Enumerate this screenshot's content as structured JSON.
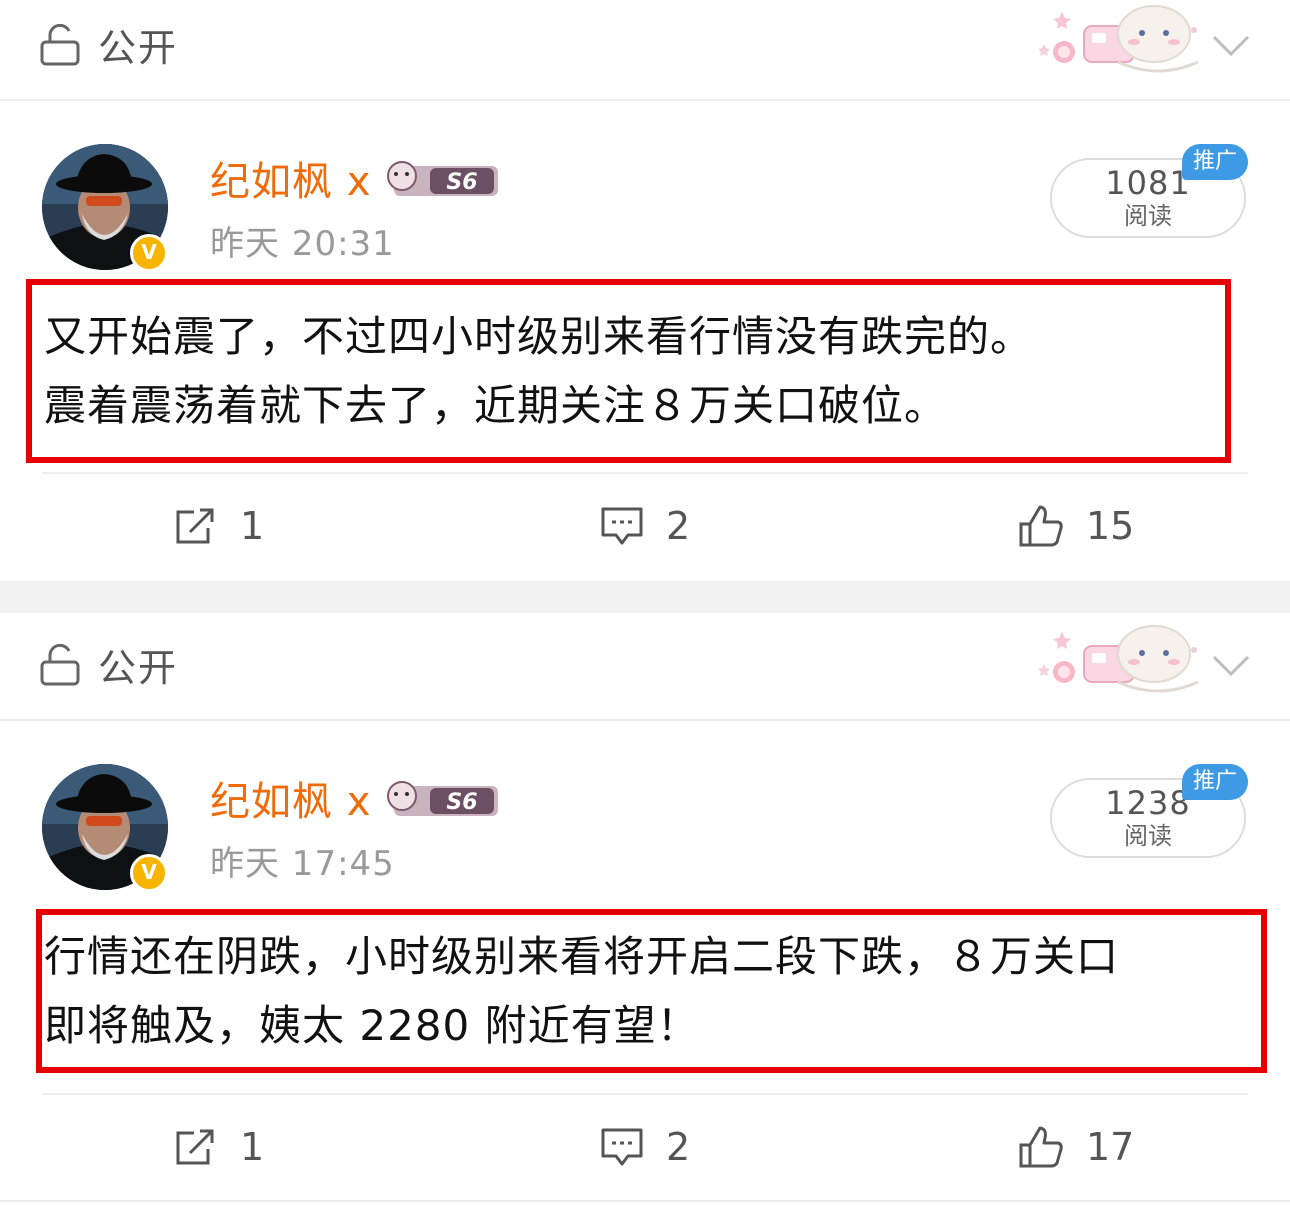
{
  "posts": [
    {
      "visibility_label": "公开",
      "author": "纪如枫 x",
      "time": "昨天 20:31",
      "reads_count": "1081",
      "reads_label": "阅读",
      "promo_badge": "推广",
      "verified_badge": "V",
      "content_lines": [
        "又开始震了，不过四小时级别来看行情没有跌完的。",
        "震着震荡着就下去了，近期关注８万关口破位。"
      ],
      "actions": {
        "repost": "1",
        "comment": "2",
        "like": "15"
      }
    },
    {
      "visibility_label": "公开",
      "author": "纪如枫 x",
      "time": "昨天 17:45",
      "reads_count": "1238",
      "reads_label": "阅读",
      "promo_badge": "推广",
      "verified_badge": "V",
      "content_lines": [
        "行情还在阴跌，小时级别来看将开启二段下跌，８万关口",
        "即将触及，姨太 2280 附近有望！"
      ],
      "actions": {
        "repost": "1",
        "comment": "2",
        "like": "17"
      }
    }
  ],
  "icons": {
    "lock": "lock-open-icon",
    "chevron": "chevron-down-icon",
    "repost": "repost-icon",
    "comment": "comment-icon",
    "like": "like-icon"
  },
  "colors": {
    "author": "#f06b0a",
    "highlight_border": "#e60000",
    "promo": "#3f9ae6",
    "verified": "#f7b500"
  }
}
